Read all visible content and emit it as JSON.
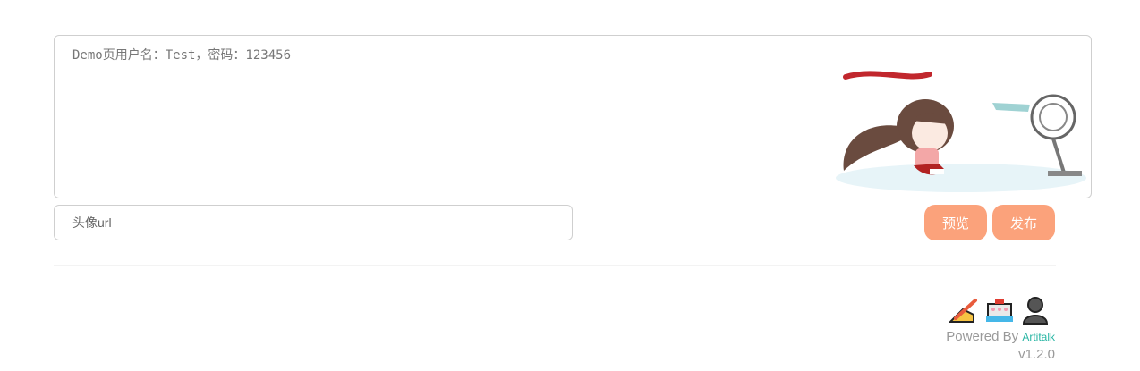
{
  "editor": {
    "text": "Demo页用户名：Test，密码：123456"
  },
  "avatar_field": {
    "placeholder": "头像url"
  },
  "buttons": {
    "preview_label": "预览",
    "publish_label": "发布"
  },
  "footer": {
    "powered_by": "Powered By",
    "brand": "Artitalk",
    "version": "v1.2.0",
    "icons": [
      "write-icon",
      "ship-icon",
      "user-icon"
    ]
  },
  "colors": {
    "accent": "#fba27b",
    "brand_link": "#27b5a3"
  }
}
